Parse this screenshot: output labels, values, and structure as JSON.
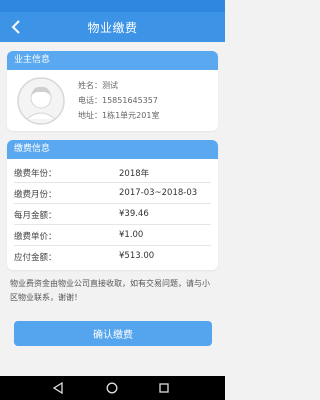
{
  "header": {
    "title": "物业缴费",
    "back_icon": "chevron-left-icon"
  },
  "owner_info": {
    "section_title": "业主信息",
    "avatar_icon": "avatar-placeholder-icon",
    "name_line": "姓名：测试",
    "phone_line": "电话：15851645357",
    "address_line": "地址：1栋1单元201室"
  },
  "payment_info": {
    "section_title": "缴费信息",
    "rows": [
      {
        "label": "缴费年份：",
        "value": "2018年"
      },
      {
        "label": "缴费月份：",
        "value": "2017-03~2018-03"
      },
      {
        "label": "每月金额：",
        "value": "¥39.46"
      },
      {
        "label": "缴费单价：",
        "value": "¥1.00"
      },
      {
        "label": "应付金额：",
        "value": "¥513.00"
      }
    ]
  },
  "notice": "物业费资金由物业公司直接收取，如有交易问题，请与小区物业联系，谢谢！",
  "confirm_button": "确认缴费",
  "system_nav": {
    "back_icon": "triangle-back-icon",
    "home_icon": "circle-home-icon",
    "recents_icon": "square-recents-icon"
  },
  "colors": {
    "primary": "#3d93e6",
    "section_header": "#5aa8ef",
    "button": "#55a4ee",
    "background": "#f2f2f2"
  }
}
